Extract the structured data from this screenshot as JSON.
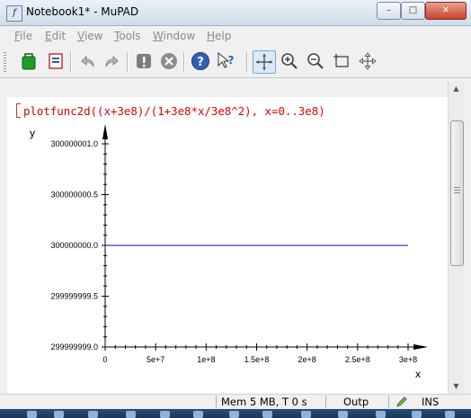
{
  "window": {
    "title": "Notebook1* - MuPAD",
    "controls": {
      "minimize": "–",
      "maximize": "□",
      "close": "✕"
    }
  },
  "menu": [
    "File",
    "Edit",
    "View",
    "Tools",
    "Window",
    "Help"
  ],
  "toolbar": [
    {
      "name": "evaluate-green-icon"
    },
    {
      "name": "notebook-icon"
    },
    {
      "name": "undo-icon"
    },
    {
      "name": "redo-icon"
    },
    {
      "name": "stop-icon"
    },
    {
      "name": "interrupt-icon"
    },
    {
      "name": "help-icon"
    },
    {
      "name": "context-help-icon"
    },
    {
      "name": "select-move-icon"
    },
    {
      "name": "zoom-in-icon"
    },
    {
      "name": "zoom-out-icon"
    },
    {
      "name": "zoom-box-icon"
    },
    {
      "name": "pan-icon"
    }
  ],
  "notebook": {
    "command": "plotfunc2d((x+3e8)/(1+3e8*x/3e8^2), x=0..3e8)"
  },
  "chart_data": {
    "type": "line",
    "title": "",
    "xlabel": "x",
    "ylabel": "y",
    "xlim": [
      0,
      300000000
    ],
    "ylim": [
      299999999.0,
      300000001.0
    ],
    "x_ticks": [
      "0",
      "5e+7",
      "1e+8",
      "1.5e+8",
      "2e+8",
      "2.5e+8",
      "3e+8"
    ],
    "y_ticks": [
      "299999999.0",
      "299999999.5",
      "300000000.0",
      "300000000.5",
      "300000001.0"
    ],
    "series": [
      {
        "x": [
          0,
          300000000
        ],
        "y": [
          300000000.0,
          300000000.0
        ],
        "color": "#0000c8"
      }
    ],
    "grid": false,
    "axis_color": "#000000"
  },
  "status": {
    "memory": "Mem 5 MB, T 0 s",
    "output": "Outp",
    "mode": "INS"
  }
}
